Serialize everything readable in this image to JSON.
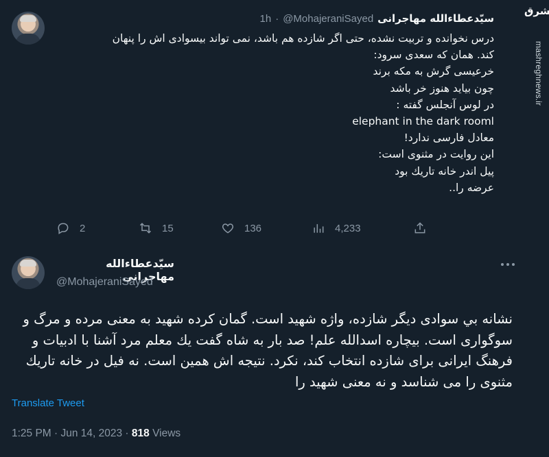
{
  "watermark": {
    "logo": "مشرق",
    "url": "mashreghnews.ir"
  },
  "tweet1": {
    "author_name": "سیّدعطاءالله مهاجرانی",
    "handle": "@MohajeraniSayed",
    "separator": "·",
    "time": "1h",
    "text": "درس نخوانده و تربیت نشده، حتی اگر شازده هم باشد، نمی تواند بیسوادی اش را پنهان\nکند. همان که سعدی  سرود:\nخرعیسی گرش به مکه برند\nچون بیاید هنوز  خر باشد\nدر  لوس آنجلس گفته :\nelephant in the  dark rooml\nمعادل فارسی ندارد!\nاین روایت در مثنوی است:\nپیل اندر خانه تاریك بود\nعرضه را..",
    "replies": "2",
    "retweets": "15",
    "likes": "136",
    "views": "4,233"
  },
  "tweet2": {
    "author_name": "سیّدعطاءالله مهاجرانی",
    "handle": "@MohajeraniSayed",
    "text": "نشانه بي سوادی دیگر شازده، واژه شهید است. گمان کرده شهید به معنی مرده و مرگ و سوگواری است. بیچاره  اسدالله علم! صد بار به شاه  گفت  یك معلم مرد آشنا با ادبیات و فرهنگ ایرانی برای شازده انتخاب کند، نکرد. نتیجه اش همین است. نه فیل در خانه تاریك مثنوی را می شناسد و نه معنی شهید را",
    "translate_label": "Translate Tweet",
    "timestamp": "1:25 PM · Jun 14, 2023 · ",
    "views_count": "818",
    "views_label": " Views"
  },
  "colors": {
    "background": "#15202b",
    "text": "#f7f9f9",
    "muted": "#8b98a5",
    "accent": "#1d9bf0"
  },
  "icons": [
    "reply-icon",
    "retweet-icon",
    "like-icon",
    "views-icon",
    "share-icon",
    "more-icon"
  ]
}
